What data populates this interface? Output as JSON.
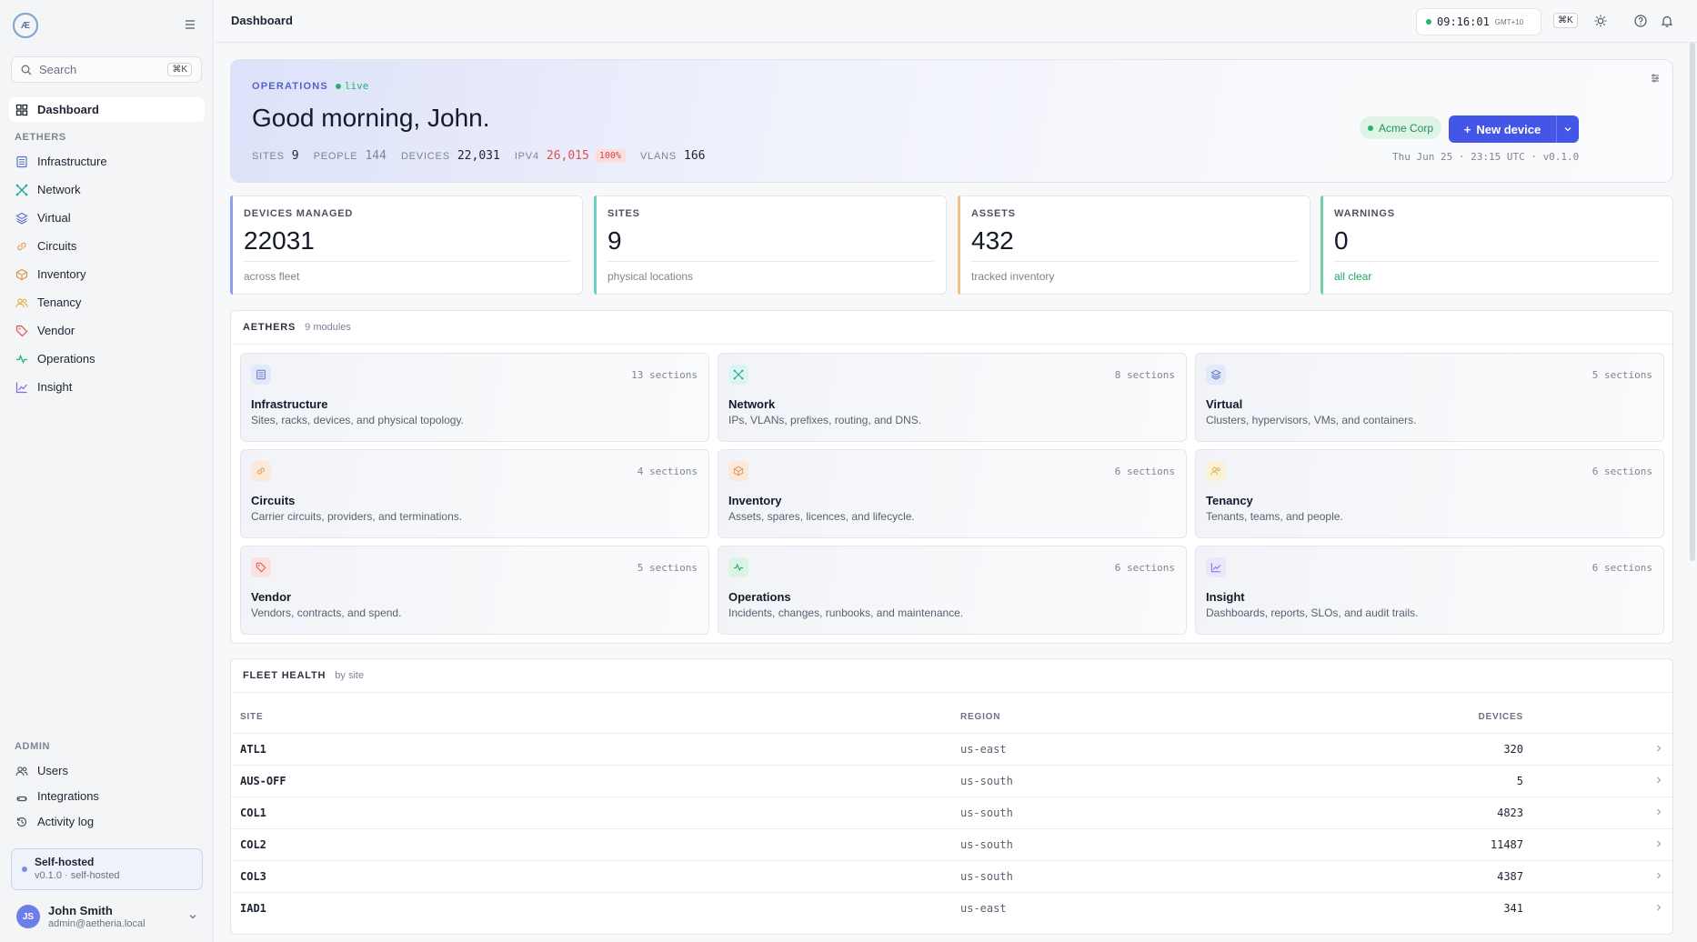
{
  "sidebar": {
    "logo_text": "Æ",
    "search": {
      "placeholder": "Search",
      "shortcut": "⌘K"
    },
    "primary": {
      "label": "Dashboard",
      "icon": "grid-icon"
    },
    "group_label": "AETHERS",
    "items": [
      {
        "label": "Infrastructure",
        "icon": "server-icon",
        "color": "#5b76c9"
      },
      {
        "label": "Network",
        "icon": "network-icon",
        "color": "#1fa89a"
      },
      {
        "label": "Virtual",
        "icon": "layers-icon",
        "color": "#5b76c9"
      },
      {
        "label": "Circuits",
        "icon": "link-icon",
        "color": "#e59a55"
      },
      {
        "label": "Inventory",
        "icon": "box-icon",
        "color": "#d9944a"
      },
      {
        "label": "Tenancy",
        "icon": "users-icon",
        "color": "#e0b04a"
      },
      {
        "label": "Vendor",
        "icon": "tag-icon",
        "color": "#e0524b"
      },
      {
        "label": "Operations",
        "icon": "pulse-icon",
        "color": "#22b26c"
      },
      {
        "label": "Insight",
        "icon": "chart-icon",
        "color": "#7c6fd6"
      }
    ],
    "admin_label": "ADMIN",
    "admin_items": [
      {
        "label": "Users",
        "icon": "users-icon"
      },
      {
        "label": "Integrations",
        "icon": "plug-icon"
      },
      {
        "label": "Activity log",
        "icon": "history-icon"
      }
    ],
    "self_hosted": {
      "title": "Self-hosted",
      "subtitle": "v0.1.0 · self-hosted"
    },
    "user": {
      "initials": "JS",
      "name": "John Smith",
      "email": "admin@aetheria.local"
    }
  },
  "topbar": {
    "breadcrumb": "Dashboard",
    "clock": "09:16:01",
    "timezone": "GMT+10",
    "shortcut": "⌘K"
  },
  "hero": {
    "eyebrow": "OPERATIONS",
    "status": "live",
    "greeting": "Good morning, John.",
    "stats": [
      {
        "key": "SITES",
        "value": "9"
      },
      {
        "key": "PEOPLE",
        "value": "144"
      },
      {
        "key": "DEVICES",
        "value": "22,031"
      },
      {
        "key": "IPV4",
        "value": "26,015",
        "badge": "100%"
      },
      {
        "key": "VLANS",
        "value": "166"
      }
    ],
    "tenant": "Acme Corp",
    "new_device_label": "New device",
    "datetime": "Thu Jun 25 · 23:15 UTC · v0.1.0"
  },
  "kpis": [
    {
      "label": "DEVICES MANAGED",
      "value": "22031",
      "sub": "across fleet",
      "color": "#8fa0e8"
    },
    {
      "label": "SITES",
      "value": "9",
      "sub": "physical locations",
      "color": "#6fd0c3"
    },
    {
      "label": "ASSETS",
      "value": "432",
      "sub": "tracked inventory",
      "color": "#e8c48a"
    },
    {
      "label": "WARNINGS",
      "value": "0",
      "sub": "all clear",
      "color": "#6fd0a6"
    }
  ],
  "aethers": {
    "title": "AETHERS",
    "count": "9 modules",
    "cards": [
      {
        "title": "Infrastructure",
        "desc": "Sites, racks, devices, and physical topology.",
        "sections": "13 sections",
        "icon": "server-icon",
        "color": "#5b76c9",
        "bg": "#e4e9fa"
      },
      {
        "title": "Network",
        "desc": "IPs, VLANs, prefixes, routing, and DNS.",
        "sections": "8 sections",
        "icon": "network-icon",
        "color": "#1fa89a",
        "bg": "#dcf3ef"
      },
      {
        "title": "Virtual",
        "desc": "Clusters, hypervisors, VMs, and containers.",
        "sections": "5 sections",
        "icon": "layers-icon",
        "color": "#5b76c9",
        "bg": "#e4e9fa"
      },
      {
        "title": "Circuits",
        "desc": "Carrier circuits, providers, and terminations.",
        "sections": "4 sections",
        "icon": "link-icon",
        "color": "#e59a55",
        "bg": "#fbeadc"
      },
      {
        "title": "Inventory",
        "desc": "Assets, spares, licences, and lifecycle.",
        "sections": "6 sections",
        "icon": "box-icon",
        "color": "#d9944a",
        "bg": "#fbeadc"
      },
      {
        "title": "Tenancy",
        "desc": "Tenants, teams, and people.",
        "sections": "6 sections",
        "icon": "users-icon",
        "color": "#e0b04a",
        "bg": "#fbf0d8"
      },
      {
        "title": "Vendor",
        "desc": "Vendors, contracts, and spend.",
        "sections": "5 sections",
        "icon": "tag-icon",
        "color": "#e0524b",
        "bg": "#fbe1df"
      },
      {
        "title": "Operations",
        "desc": "Incidents, changes, runbooks, and maintenance.",
        "sections": "6 sections",
        "icon": "pulse-icon",
        "color": "#22b26c",
        "bg": "#ddf3e6"
      },
      {
        "title": "Insight",
        "desc": "Dashboards, reports, SLOs, and audit trails.",
        "sections": "6 sections",
        "icon": "chart-icon",
        "color": "#7c6fd6",
        "bg": "#ebe7fa"
      }
    ]
  },
  "fleet": {
    "title": "FLEET HEALTH",
    "subtitle": "by site",
    "columns": [
      "SITE",
      "REGION",
      "DEVICES"
    ],
    "rows": [
      {
        "site": "ATL1",
        "region": "us-east",
        "devices": "320"
      },
      {
        "site": "AUS-OFF",
        "region": "us-south",
        "devices": "5"
      },
      {
        "site": "COL1",
        "region": "us-south",
        "devices": "4823"
      },
      {
        "site": "COL2",
        "region": "us-south",
        "devices": "11487"
      },
      {
        "site": "COL3",
        "region": "us-south",
        "devices": "4387"
      },
      {
        "site": "IAD1",
        "region": "us-east",
        "devices": "341"
      }
    ]
  }
}
